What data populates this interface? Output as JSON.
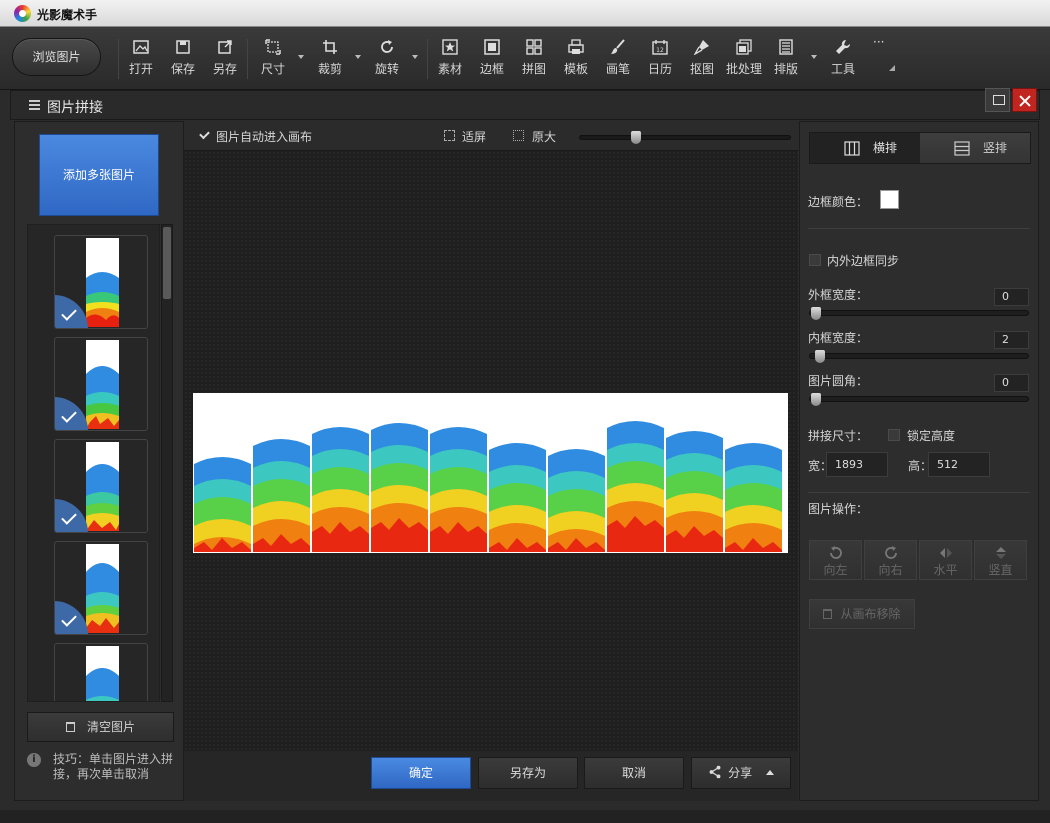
{
  "app": {
    "title": "光影魔术手"
  },
  "toolbar": {
    "browse": "浏览图片",
    "items": [
      {
        "label": "打开",
        "icon": "open-image-icon"
      },
      {
        "label": "保存",
        "icon": "save-icon"
      },
      {
        "label": "另存",
        "icon": "save-as-icon"
      },
      {
        "label": "尺寸",
        "icon": "resize-icon"
      },
      {
        "label": "裁剪",
        "icon": "crop-icon"
      },
      {
        "label": "旋转",
        "icon": "rotate-icon"
      },
      {
        "label": "素材",
        "icon": "material-star-icon"
      },
      {
        "label": "边框",
        "icon": "border-frame-icon"
      },
      {
        "label": "拼图",
        "icon": "collage-grid-icon"
      },
      {
        "label": "模板",
        "icon": "template-printer-icon"
      },
      {
        "label": "画笔",
        "icon": "brush-icon"
      },
      {
        "label": "日历",
        "icon": "calendar-icon"
      },
      {
        "label": "抠图",
        "icon": "cutout-pen-icon"
      },
      {
        "label": "批处理",
        "icon": "batch-process-icon"
      },
      {
        "label": "排版",
        "icon": "layout-icon"
      },
      {
        "label": "工具",
        "icon": "wrench-tool-icon"
      }
    ],
    "more": "···"
  },
  "panel": {
    "title": "图片拼接"
  },
  "left": {
    "add_button": "添加多张图片",
    "clear_button": "清空图片",
    "tip": "技巧：单击图片进入拼接，再次单击取消",
    "thumbnails": [
      {
        "checked": true
      },
      {
        "checked": true
      },
      {
        "checked": true
      },
      {
        "checked": true
      },
      {
        "checked": false
      }
    ]
  },
  "canvas": {
    "auto_enter_label": "图片自动进入画布",
    "auto_enter_checked": true,
    "fit_label": "适屏",
    "original_label": "原大",
    "zoom_level": 0.25,
    "slot_count": 10
  },
  "actions": {
    "ok": "确定",
    "save_as": "另存为",
    "cancel": "取消",
    "share": "分享"
  },
  "right": {
    "layout_horizontal": "横排",
    "layout_vertical": "竖排",
    "active_layout": "横排",
    "border_color_label": "边框颜色：",
    "border_color": "#ffffff",
    "sync_label": "内外边框同步",
    "sync_checked": false,
    "outer_width_label": "外框宽度：",
    "outer_width": "0",
    "inner_width_label": "内框宽度：",
    "inner_width": "2",
    "corner_label": "图片圆角：",
    "corner": "0",
    "size_label": "拼接尺寸：",
    "lock_height_label": "锁定高度",
    "lock_height_checked": false,
    "width_label": "宽：",
    "width_value": "1893",
    "height_label": "高：",
    "height_value": "512",
    "ops_label": "图片操作：",
    "op_left": "向左",
    "op_right": "向右",
    "op_horizontal": "水平",
    "op_vertical": "竖直",
    "remove_label": "从画布移除"
  }
}
